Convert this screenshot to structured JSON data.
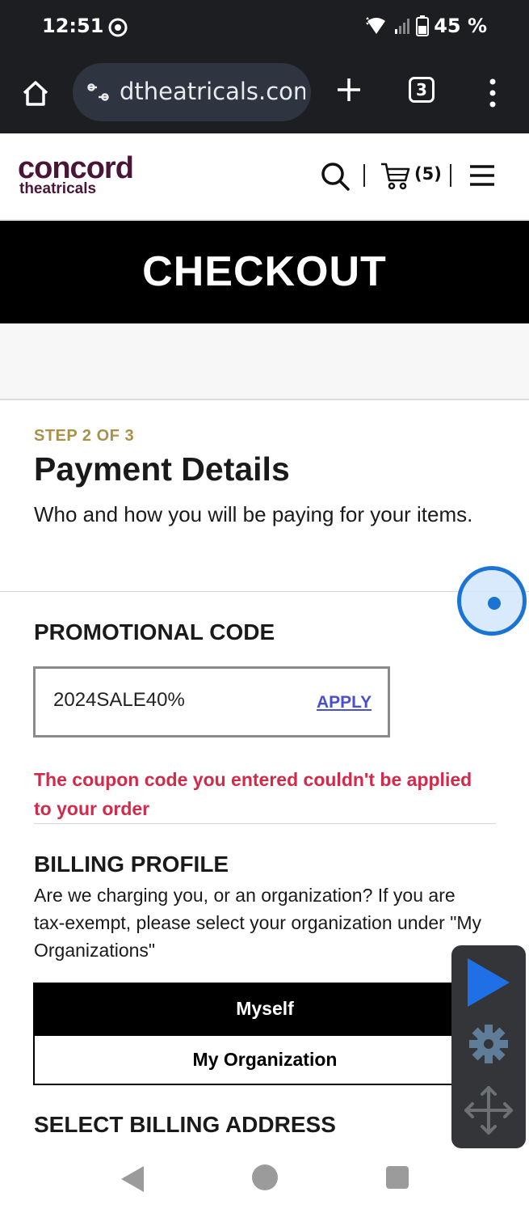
{
  "status_bar": {
    "time": "12:51",
    "battery": "45 %"
  },
  "browser": {
    "url": "dtheatricals.com",
    "tab_count": "3"
  },
  "site": {
    "logo_main": "concord",
    "logo_sub": "theatricals",
    "cart_count": "(5)"
  },
  "banner": {
    "title": "CHECKOUT"
  },
  "step": {
    "label": "STEP 2 OF 3",
    "title": "Payment Details",
    "subtitle": "Who and how you will be paying for your items."
  },
  "promo": {
    "heading": "PROMOTIONAL CODE",
    "value": "2024SALE40%",
    "apply_label": "APPLY",
    "error": "The coupon code you entered couldn't be applied to your order"
  },
  "billing": {
    "heading": "BILLING PROFILE",
    "description": "Are we charging you, or an organization? If you are tax-exempt, please select your organization under \"My Organizations\"",
    "option_myself": "Myself",
    "option_org": "My Organization"
  },
  "address": {
    "heading": "SELECT BILLING ADDRESS"
  },
  "colors": {
    "brand": "#4a1638",
    "step_gold": "#a99149",
    "error_red": "#d12a4a",
    "link_blue": "#4a4fd0",
    "overlay_blue": "#1b73d3"
  },
  "icons": [
    "chrome-icon",
    "wifi-icon",
    "signal-icon",
    "battery-icon",
    "home-icon",
    "site-info-icon",
    "new-tab-icon",
    "tabs-icon",
    "more-icon",
    "search-icon",
    "cart-icon",
    "hamburger-icon",
    "play-icon",
    "gear-icon",
    "move-icon",
    "nav-back-icon",
    "nav-home-icon",
    "nav-recents-icon"
  ]
}
